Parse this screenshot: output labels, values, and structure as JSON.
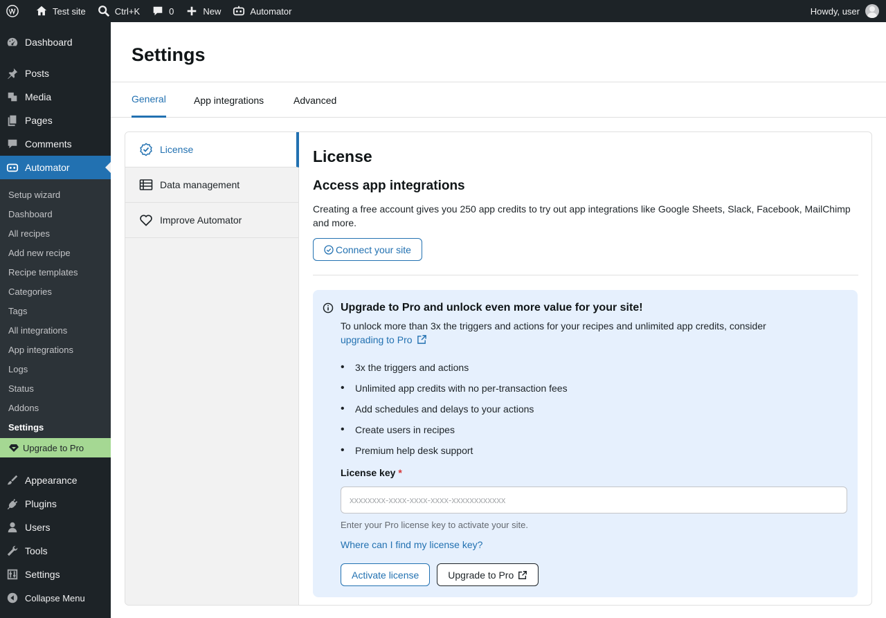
{
  "adminbar": {
    "site_name": "Test site",
    "search_shortcut": "Ctrl+K",
    "comments_count": "0",
    "new_label": "New",
    "automator_label": "Automator",
    "greeting": "Howdy, user"
  },
  "sidebar": {
    "items_top": [
      {
        "label": "Dashboard",
        "icon": "dashboard-icon"
      },
      {
        "label": "Posts",
        "icon": "pin-icon"
      },
      {
        "label": "Media",
        "icon": "media-icon"
      },
      {
        "label": "Pages",
        "icon": "pages-icon"
      },
      {
        "label": "Comments",
        "icon": "comment-icon"
      }
    ],
    "current": {
      "label": "Automator",
      "icon": "automator-icon"
    },
    "submenu": [
      "Setup wizard",
      "Dashboard",
      "All recipes",
      "Add new recipe",
      "Recipe templates",
      "Categories",
      "Tags",
      "All integrations",
      "App integrations",
      "Logs",
      "Status",
      "Addons",
      "Settings"
    ],
    "submenu_active": "Settings",
    "upgrade_label": "Upgrade to Pro",
    "items_bottom": [
      {
        "label": "Appearance",
        "icon": "brush-icon"
      },
      {
        "label": "Plugins",
        "icon": "plugin-icon"
      },
      {
        "label": "Users",
        "icon": "user-icon"
      },
      {
        "label": "Tools",
        "icon": "wrench-icon"
      },
      {
        "label": "Settings",
        "icon": "sliders-icon"
      }
    ],
    "collapse_label": "Collapse Menu"
  },
  "page": {
    "title": "Settings",
    "tabs": [
      "General",
      "App integrations",
      "Advanced"
    ],
    "active_tab": "General"
  },
  "leftnav": {
    "items": [
      {
        "label": "License",
        "icon": "badge-check-icon",
        "active": true
      },
      {
        "label": "Data management",
        "icon": "table-icon",
        "active": false
      },
      {
        "label": "Improve Automator",
        "icon": "heart-icon",
        "active": false
      }
    ]
  },
  "license": {
    "heading": "License",
    "subheading": "Access app integrations",
    "description": "Creating a free account gives you 250 app credits to try out app integrations like Google Sheets, Slack, Facebook, MailChimp and more.",
    "connect_button": "Connect your site",
    "upgrade_notice": {
      "title": "Upgrade to Pro and unlock even more value for your site!",
      "text": "To unlock more than 3x the triggers and actions for your recipes and unlimited app credits, consider",
      "link_text": "upgrading to Pro",
      "benefits": [
        "3x the triggers and actions",
        "Unlimited app credits with no per-transaction fees",
        "Add schedules and delays to your actions",
        "Create users in recipes",
        "Premium help desk support"
      ]
    },
    "key_label": "License key",
    "key_required_mark": "*",
    "key_value": "",
    "key_placeholder": "xxxxxxxx-xxxx-xxxx-xxxx-xxxxxxxxxxxx",
    "key_hint": "Enter your Pro license key to activate your site.",
    "find_key_link": "Where can I find my license key?",
    "activate_button": "Activate license",
    "upgrade_button": "Upgrade to Pro"
  },
  "colors": {
    "accent": "#2271b1",
    "sidebar_bg": "#1d2327",
    "notice_bg": "#e6f0fd",
    "upgrade_bg": "#a5d893",
    "required": "#d63638"
  }
}
